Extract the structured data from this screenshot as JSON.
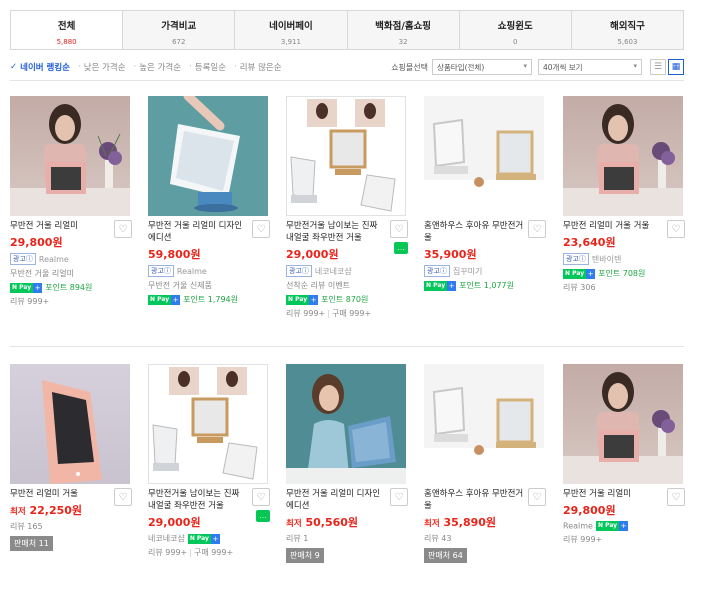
{
  "tabs": [
    {
      "label": "전체",
      "count": "5,880"
    },
    {
      "label": "가격비교",
      "count": "672"
    },
    {
      "label": "네이버페이",
      "count": "3,911"
    },
    {
      "label": "백화점/홈쇼핑",
      "count": "32"
    },
    {
      "label": "쇼핑윈도",
      "count": "0"
    },
    {
      "label": "해외직구",
      "count": "5,603"
    }
  ],
  "sort": {
    "options": [
      "네이버 랭킹순",
      "낮은 가격순",
      "높은 가격순",
      "등록일순",
      "리뷰 많은순"
    ],
    "mall_label": "쇼핑몰선택",
    "type_select": "상품타입(전체)",
    "count_select": "40개씩 보기"
  },
  "products_row1": [
    {
      "name": "무반전 거울 리얼미",
      "price": "29,800원",
      "ad": "광고",
      "mall": "Realme",
      "point": "포인트 894원",
      "review": "리뷰 999+"
    },
    {
      "name": "무반전 거울 리얼미 디자인 에디션",
      "price": "59,800원",
      "ad": "광고",
      "mall": "Realme",
      "mall2": "무반전 거울 신제품",
      "point": "포인트 1,794원"
    },
    {
      "name": "무반전거울 남이보는 진짜 내얼굴 좌우반전 거울",
      "price": "29,000원",
      "ad": "광고",
      "mall": "네코네코샵",
      "mall2": "선착순 리뷰 이벤트",
      "point": "포인트 870원",
      "review": "리뷰 999+",
      "purchase": "구매 999+"
    },
    {
      "name": "홈앤하우스 후아유 무반전거울",
      "price": "35,900원",
      "ad": "광고",
      "mall": "집꾸미기",
      "point": "포인트 1,077원"
    },
    {
      "name": "무반전 리얼미 거울 거울",
      "price": "23,640원",
      "ad": "광고",
      "mall": "텐바이텐",
      "point": "포인트 708원",
      "review": "리뷰 306"
    }
  ],
  "mall_row1_first": "무반전 거울 리얼미",
  "products_row2": [
    {
      "name": "무반전 리얼미 거울",
      "price_prefix": "최저",
      "price": "22,250원",
      "review": "리뷰 165",
      "sellers": "판매처 11"
    },
    {
      "name": "무반전거울 남이보는 진짜 내얼굴 좌우반전 거울",
      "price": "29,000원",
      "mall": "네코네코샵",
      "review": "리뷰 999+",
      "purchase": "구매 999+"
    },
    {
      "name": "무반전 거울 리얼미 디자인 에디션",
      "price_prefix": "최저",
      "price": "50,560원",
      "review": "리뷰 1",
      "sellers": "판매처 9"
    },
    {
      "name": "홈앤하우스 후아유 무반전거울",
      "price_prefix": "최저",
      "price": "35,890원",
      "review": "리뷰 43",
      "sellers": "판매처 64"
    },
    {
      "name": "무반전 거울 리얼미",
      "price": "29,800원",
      "mall": "Realme",
      "review": "리뷰 999+"
    }
  ],
  "badges": {
    "npay": "N Pay",
    "plus": "+"
  },
  "colors": {
    "price": "#e8241a",
    "accent": "#1e5cd6",
    "point": "#1ca542"
  }
}
